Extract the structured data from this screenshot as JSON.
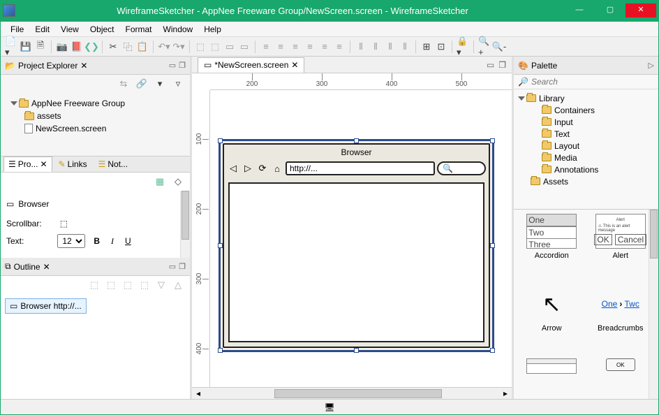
{
  "window": {
    "title": "WireframeSketcher - AppNee Freeware Group/NewScreen.screen - WireframeSketcher"
  },
  "menu": {
    "items": [
      "File",
      "Edit",
      "View",
      "Object",
      "Format",
      "Window",
      "Help"
    ]
  },
  "explorer": {
    "title": "Project Explorer",
    "root": "AppNee Freeware Group",
    "children": [
      "assets",
      "NewScreen.screen"
    ]
  },
  "propertyTabs": {
    "prop": "Pro...",
    "links": "Links",
    "notes": "Not..."
  },
  "properties": {
    "title": "Browser",
    "scrollbar_label": "Scrollbar:",
    "text_label": "Text:",
    "font_size": "12"
  },
  "outline": {
    "title": "Outline",
    "item": "Browser http://..."
  },
  "editor": {
    "tab": "*NewScreen.screen",
    "ruler": [
      "200",
      "300",
      "400",
      "500"
    ],
    "vruler": [
      "100",
      "200",
      "300",
      "400"
    ],
    "browser_title": "Browser",
    "browser_url": "http://..."
  },
  "palette": {
    "title": "Palette",
    "search_placeholder": "Search",
    "library": "Library",
    "cats": [
      "Containers",
      "Input",
      "Text",
      "Layout",
      "Media",
      "Annotations"
    ],
    "assets": "Assets",
    "items": {
      "accordion": "Accordion",
      "alert": "Alert",
      "arrow": "Arrow",
      "breadcrumbs": "Breadcrumbs",
      "bc_one": "One",
      "bc_two": "Twc"
    }
  }
}
